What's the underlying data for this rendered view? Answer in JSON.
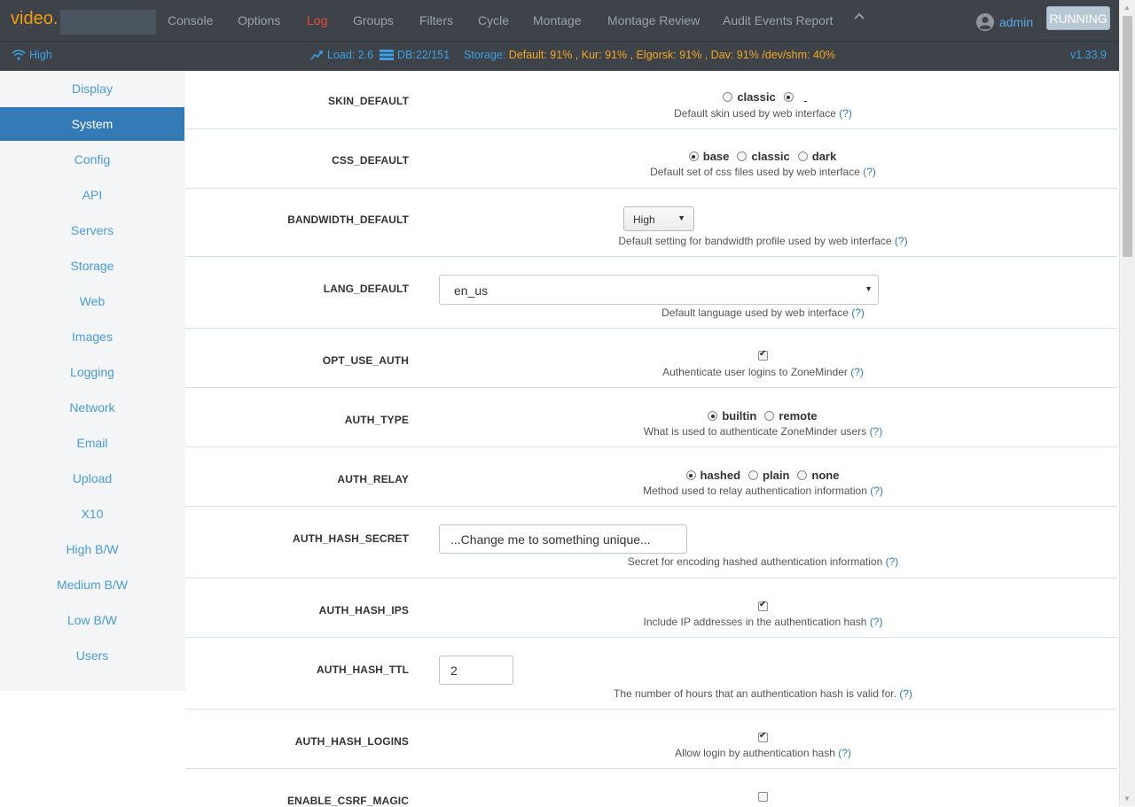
{
  "brand": {
    "name": "video."
  },
  "nav": {
    "items": [
      "Console",
      "Options",
      "Log",
      "Groups",
      "Filters",
      "Cycle",
      "Montage",
      "Montage Review",
      "Audit Events Report"
    ],
    "active": "Log",
    "user": "admin",
    "state": "RUNNING"
  },
  "status": {
    "bandwidth": "High",
    "load": "Load: 2.6",
    "db": "DB:22/151",
    "storage_label": "Storage:",
    "storage_values": "Default: 91% , Kur: 91% , Elgorsk: 91% , Dav: 91% /dev/shm: 40%",
    "version": "v1.33.9"
  },
  "sidebar": {
    "items": [
      "Display",
      "System",
      "Config",
      "API",
      "Servers",
      "Storage",
      "Web",
      "Images",
      "Logging",
      "Network",
      "Email",
      "Upload",
      "X10",
      "High B/W",
      "Medium B/W",
      "Low B/W",
      "Users"
    ],
    "active": "System"
  },
  "settings": [
    {
      "name": "SKIN_DEFAULT",
      "desc": "Default skin used by web interface",
      "help": "(?)",
      "options": [
        "classic",
        ""
      ],
      "selected": 1
    },
    {
      "name": "CSS_DEFAULT",
      "desc": "Default set of css files used by web interface",
      "help": "(?)",
      "options": [
        "base",
        "classic",
        "dark"
      ],
      "selected": 0
    },
    {
      "name": "BANDWIDTH_DEFAULT",
      "desc": "Default setting for bandwidth profile used by web interface",
      "help": "(?)",
      "value": "High"
    },
    {
      "name": "LANG_DEFAULT",
      "desc": "Default language used by web interface",
      "help": "(?)",
      "value": "en_us"
    },
    {
      "name": "OPT_USE_AUTH",
      "desc": "Authenticate user logins to ZoneMinder",
      "help": "(?)",
      "checked": true
    },
    {
      "name": "AUTH_TYPE",
      "desc": "What is used to authenticate ZoneMinder users",
      "help": "(?)",
      "options": [
        "builtin",
        "remote"
      ],
      "selected": 0
    },
    {
      "name": "AUTH_RELAY",
      "desc": "Method used to relay authentication information",
      "help": "(?)",
      "options": [
        "hashed",
        "plain",
        "none"
      ],
      "selected": 0
    },
    {
      "name": "AUTH_HASH_SECRET",
      "desc": "Secret for encoding hashed authentication information",
      "help": "(?)",
      "value": "...Change me to something unique..."
    },
    {
      "name": "AUTH_HASH_IPS",
      "desc": "Include IP addresses in the authentication hash",
      "help": "(?)",
      "checked": true
    },
    {
      "name": "AUTH_HASH_TTL",
      "desc": "The number of hours that an authentication hash is valid for.",
      "help": "(?)",
      "value": "2"
    },
    {
      "name": "AUTH_HASH_LOGINS",
      "desc": "Allow login by authentication hash",
      "help": "(?)",
      "checked": true
    },
    {
      "name": "ENABLE_CSRF_MAGIC",
      "checked": false
    }
  ]
}
